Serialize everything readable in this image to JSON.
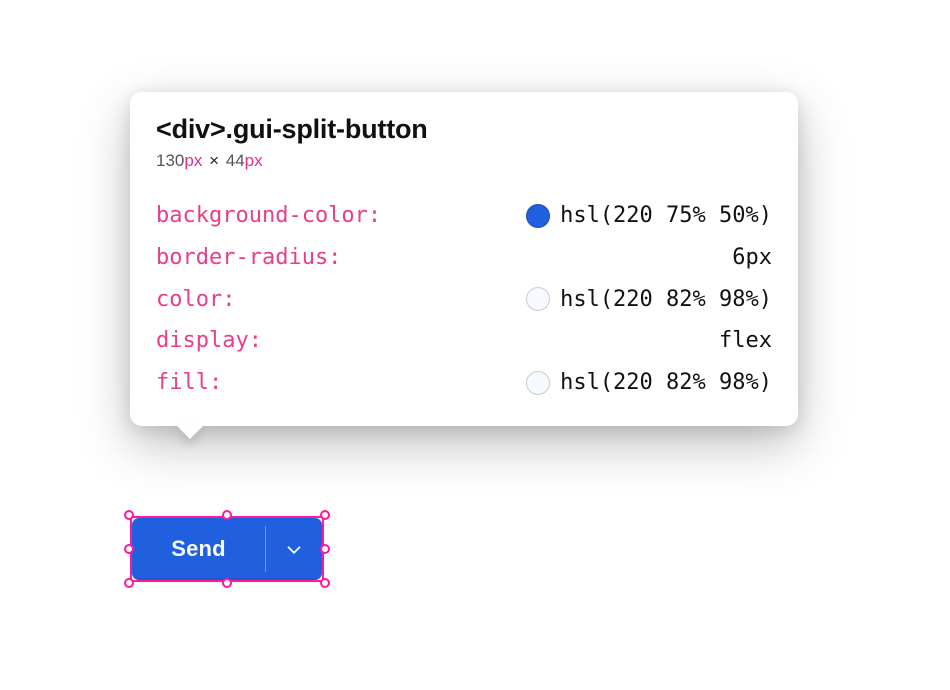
{
  "tooltip": {
    "element_tag": "<div>",
    "element_class": ".gui-split-button",
    "dims": {
      "w": "130",
      "w_unit": "px",
      "times": "×",
      "h": "44",
      "h_unit": "px"
    },
    "props": [
      {
        "name": "background-color",
        "value": "hsl(220 75% 50%)",
        "swatch": "hsl(220 75% 50%)"
      },
      {
        "name": "border-radius",
        "value": "6px"
      },
      {
        "name": "color",
        "value": "hsl(220 82% 98%)",
        "swatch": "hsl(220 82% 98%)"
      },
      {
        "name": "display",
        "value": "flex"
      },
      {
        "name": "fill",
        "value": "hsl(220 82% 98%)",
        "swatch": "hsl(220 82% 98%)"
      }
    ]
  },
  "button": {
    "label": "Send",
    "accent": "hsl(220 75% 50%)",
    "fg": "hsl(220 82% 98%)"
  }
}
